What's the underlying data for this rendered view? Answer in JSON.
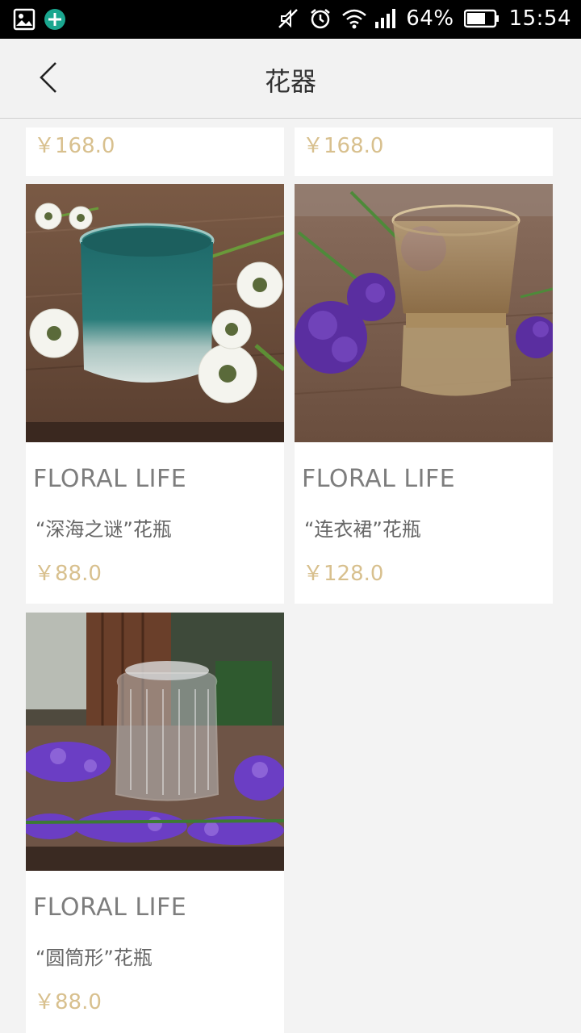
{
  "status_bar": {
    "battery": "64%",
    "time": "15:54"
  },
  "header": {
    "title": "花器"
  },
  "cards": [
    {
      "price": "￥168.0"
    },
    {
      "price": "￥168.0"
    },
    {
      "brand": "FLORAL LIFE",
      "name": "“深海之谜”花瓶",
      "price": "￥88.0"
    },
    {
      "brand": "FLORAL LIFE",
      "name": "“连衣裙”花瓶",
      "price": "￥128.0"
    },
    {
      "brand": "FLORAL LIFE",
      "name": "“圆筒形”花瓶",
      "price": "￥88.0"
    }
  ]
}
